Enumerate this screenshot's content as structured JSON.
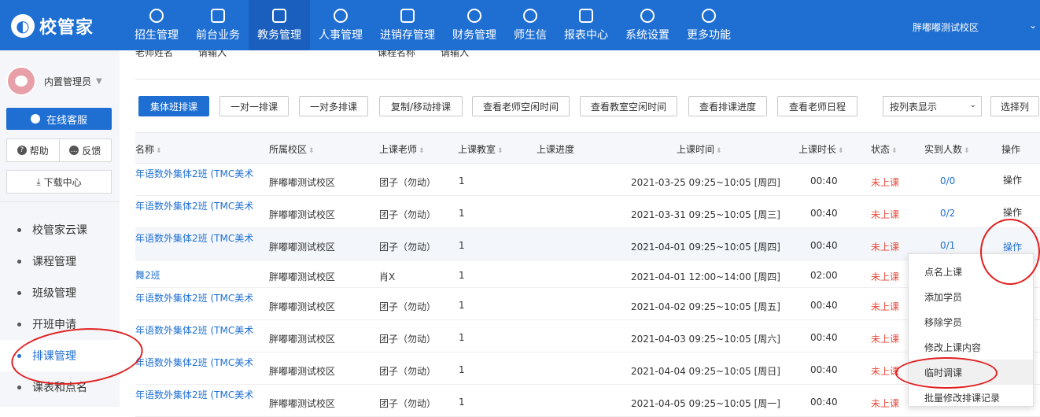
{
  "app": {
    "logo_text": "校管家",
    "campus_select": "胖嘟嘟测试校区"
  },
  "nav": [
    {
      "label": "招生管理",
      "icon": "user-plus-icon"
    },
    {
      "label": "前台业务",
      "icon": "desk-icon"
    },
    {
      "label": "教务管理",
      "icon": "book-icon",
      "active": true
    },
    {
      "label": "人事管理",
      "icon": "person-icon"
    },
    {
      "label": "进销存管理",
      "icon": "inventory-icon"
    },
    {
      "label": "财务管理",
      "icon": "finance-icon"
    },
    {
      "label": "师生信",
      "icon": "message-icon"
    },
    {
      "label": "报表中心",
      "icon": "report-icon"
    },
    {
      "label": "系统设置",
      "icon": "settings-icon"
    },
    {
      "label": "更多功能",
      "icon": "more-icon"
    }
  ],
  "sidebar": {
    "user_name": "内置管理员",
    "online_service": "在线客服",
    "help": "帮助",
    "feedback": "反馈",
    "download_center": "下载中心",
    "menu": [
      {
        "label": "校管家云课"
      },
      {
        "label": "课程管理"
      },
      {
        "label": "班级管理"
      },
      {
        "label": "开班申请"
      },
      {
        "label": "排课管理",
        "active": true
      },
      {
        "label": "课表和点名"
      }
    ]
  },
  "filters": {
    "teacher_label": "老师姓名",
    "teacher_value": "请输入",
    "course_label": "课程名称",
    "course_value": "请输入"
  },
  "toolbar": {
    "buttons": [
      "集体班排课",
      "一对一排课",
      "一对多排课",
      "复制/移动排课",
      "查看老师空闲时间",
      "查看教室空闲时间",
      "查看排课进度",
      "查看老师日程"
    ],
    "view_select": "按列表显示",
    "select_columns": "选择列"
  },
  "table": {
    "headers": [
      "名称",
      "所属校区",
      "上课老师",
      "上课教室",
      "上课进度",
      "上课时间",
      "上课时长",
      "状态",
      "实到人数",
      "操作"
    ],
    "rows": [
      {
        "name": "年语数外集体2班 (TMC美术",
        "campus": "胖嘟嘟测试校区",
        "teacher": "团子（勿动）",
        "room": "1",
        "time": "2021-03-25 09:25~10:05 [周四]",
        "duration": "00:40",
        "status": "未上课",
        "attendance": "0/0",
        "op": "操作"
      },
      {
        "name": "年语数外集体2班 (TMC美术",
        "campus": "胖嘟嘟测试校区",
        "teacher": "团子（勿动）",
        "room": "1",
        "time": "2021-03-31 09:25~10:05 [周三]",
        "duration": "00:40",
        "status": "未上课",
        "attendance": "0/2",
        "op": "操作"
      },
      {
        "name": "年语数外集体2班 (TMC美术",
        "campus": "胖嘟嘟测试校区",
        "teacher": "团子（勿动）",
        "room": "1",
        "time": "2021-04-01 09:25~10:05 [周四]",
        "duration": "00:40",
        "status": "未上课",
        "attendance": "0/1",
        "op": "操作"
      },
      {
        "name": "舞2班",
        "campus": "胖嘟嘟测试校区",
        "teacher": "肖X",
        "room": "1",
        "time": "2021-04-01 12:00~14:00 [周四]",
        "duration": "02:00",
        "status": "未上课",
        "attendance": "",
        "op": ""
      },
      {
        "name": "年语数外集体2班 (TMC美术",
        "campus": "胖嘟嘟测试校区",
        "teacher": "团子（勿动）",
        "room": "1",
        "time": "2021-04-02 09:25~10:05 [周五]",
        "duration": "00:40",
        "status": "未上课",
        "attendance": "",
        "op": ""
      },
      {
        "name": "年语数外集体2班 (TMC美术",
        "campus": "胖嘟嘟测试校区",
        "teacher": "团子（勿动）",
        "room": "1",
        "time": "2021-04-03 09:25~10:05 [周六]",
        "duration": "00:40",
        "status": "未上课",
        "attendance": "",
        "op": ""
      },
      {
        "name": "年语数外集体2班 (TMC美术",
        "campus": "胖嘟嘟测试校区",
        "teacher": "团子（勿动）",
        "room": "1",
        "time": "2021-04-04 09:25~10:05 [周日]",
        "duration": "00:40",
        "status": "未上课",
        "attendance": "",
        "op": ""
      },
      {
        "name": "年语数外集体2班 (TMC美术",
        "campus": "胖嘟嘟测试校区",
        "teacher": "团子（勿动）",
        "room": "1",
        "time": "2021-04-05 09:25~10:05 [周一]",
        "duration": "00:40",
        "status": "未上课",
        "attendance": "",
        "op": ""
      }
    ]
  },
  "op_menu": [
    "点名上课",
    "添加学员",
    "移除学员",
    "修改上课内容",
    "临时调课",
    "批量修改排课记录"
  ],
  "colors": {
    "brand": "#1f6fd3",
    "status_red": "#e64b3b",
    "annotation": "#e02020"
  }
}
